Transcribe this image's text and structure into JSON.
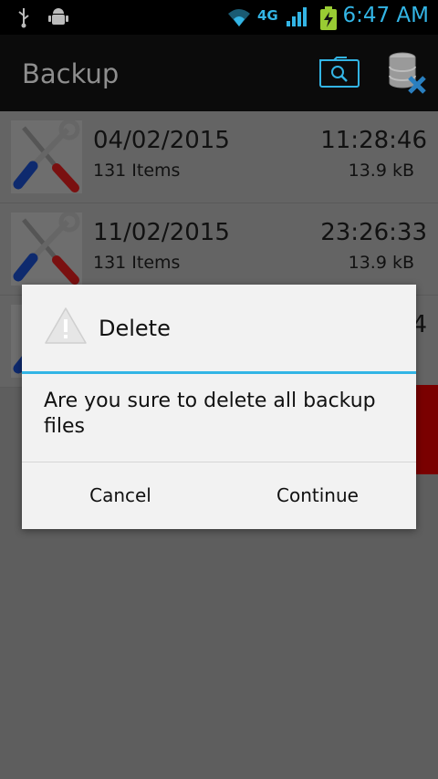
{
  "status_bar": {
    "time": "6:47 AM",
    "network": "4G",
    "icons": [
      "usb-icon",
      "android-debug-icon",
      "wifi-icon",
      "signal-icon",
      "battery-charging-icon"
    ],
    "accent_color": "#33b5e5"
  },
  "action_bar": {
    "title": "Backup",
    "actions": [
      "search-folder-icon",
      "database-delete-icon"
    ]
  },
  "backups": [
    {
      "date": "04/02/2015",
      "time": "11:28:46",
      "items": "131 Items",
      "size": "13.9 kB"
    },
    {
      "date": "11/02/2015",
      "time": "23:26:33",
      "items": "131 Items",
      "size": "13.9 kB"
    }
  ],
  "partial_row_time_fragment": "4",
  "dialog": {
    "title": "Delete",
    "message": "Are you sure to delete all backup files",
    "cancel": "Cancel",
    "continue": "Continue",
    "accent_line_color": "#33b5e5"
  }
}
